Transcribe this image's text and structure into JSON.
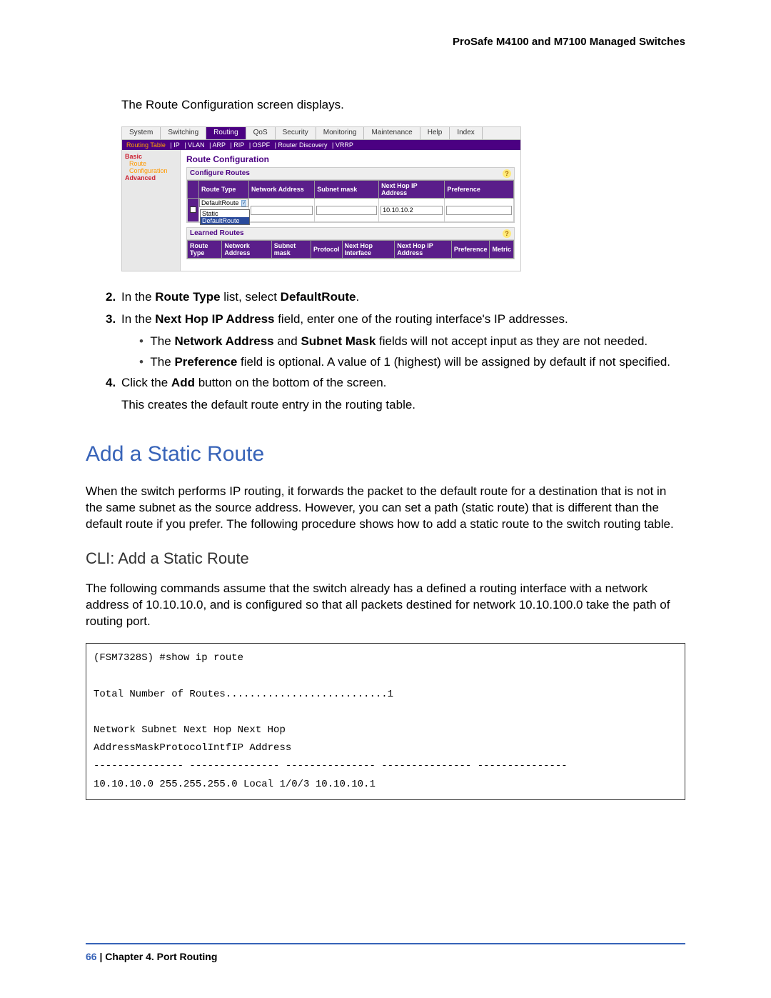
{
  "header": "ProSafe M4100 and M7100 Managed Switches",
  "intro": "The Route Configuration screen displays.",
  "ui": {
    "tabs": [
      "System",
      "Switching",
      "Routing",
      "QoS",
      "Security",
      "Monitoring",
      "Maintenance",
      "Help",
      "Index"
    ],
    "active_tab": "Routing",
    "subtabs": [
      "Routing Table",
      "IP",
      "VLAN",
      "ARP",
      "RIP",
      "OSPF",
      "Router Discovery",
      "VRRP"
    ],
    "sidebar": {
      "basic": "Basic",
      "routeconf": "Route Configuration",
      "advanced": "Advanced"
    },
    "main_title": "Route Configuration",
    "configure_routes": {
      "title": "Configure Routes",
      "headers": [
        "Route Type",
        "Network Address",
        "Subnet mask",
        "Next Hop IP Address",
        "Preference"
      ],
      "route_type_value": "DefaultRoute",
      "dropdown_options": [
        "Static",
        "DefaultRoute"
      ],
      "next_hop_value": "10.10.10.2"
    },
    "learned_routes": {
      "title": "Learned Routes",
      "headers": [
        "Route Type",
        "Network Address",
        "Subnet mask",
        "Protocol",
        "Next Hop Interface",
        "Next Hop IP Address",
        "Preference",
        "Metric"
      ]
    }
  },
  "steps": {
    "s2_num": "2.",
    "s2_pre": "In the ",
    "s2_b1": "Route Type",
    "s2_mid": " list, select ",
    "s2_b2": "DefaultRoute",
    "s2_post": ".",
    "s3_num": "3.",
    "s3_pre": "In the ",
    "s3_b1": "Next Hop IP Address",
    "s3_post": " field, enter one of the routing interface's IP addresses.",
    "s3_bullet1_pre": "The ",
    "s3_bullet1_b1": "Network Address",
    "s3_bullet1_mid": " and ",
    "s3_bullet1_b2": "Subnet Mask",
    "s3_bullet1_post": " fields will not accept input as they are not needed.",
    "s3_bullet2_pre": "The ",
    "s3_bullet2_b1": "Preference",
    "s3_bullet2_post": " field is optional. A value of 1 (highest) will be assigned by default if not specified.",
    "s4_num": "4.",
    "s4_pre": "Click the ",
    "s4_b1": "Add",
    "s4_post": " button on the bottom of the screen.",
    "s4_cont": "This creates the default route entry in the routing table."
  },
  "h1": "Add a Static Route",
  "para1": "When the switch performs IP routing, it forwards the packet to the default route for a destination that is not in the same subnet as the source address. However, you can set a path (static route) that is different than the default route if you prefer. The following procedure shows how to add a static route to the switch routing table.",
  "h2": "CLI: Add a Static Route",
  "para2": "The following commands assume that the switch already has a defined a routing interface with a network address of 10.10.10.0, and is configured so that all packets destined for network 10.10.100.0 take the path of routing port.",
  "code": "(FSM7328S) #show ip route\n\nTotal Number of Routes...........................1\n\nNetwork Subnet Next Hop Next Hop\nAddressMaskProtocolIntfIP Address\n--------------- --------------- --------------- --------------- ---------------\n10.10.10.0 255.255.255.0 Local 1/0/3 10.10.10.1",
  "footer": {
    "page": "66",
    "sep": " | ",
    "chapter": "Chapter 4.  Port Routing"
  }
}
